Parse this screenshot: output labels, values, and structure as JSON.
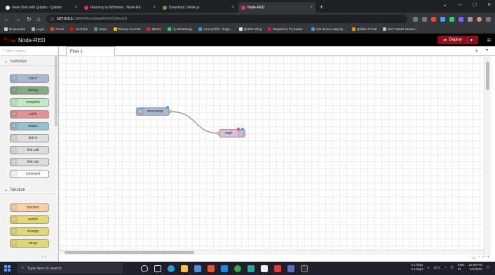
{
  "browser": {
    "tabs": [
      {
        "title": "Node Red with Qubitro - Qubitro",
        "color": "#ffffff",
        "active": false
      },
      {
        "title": "Running on Windows : Node-RE",
        "color": "#e23a3a",
        "active": false
      },
      {
        "title": "Download | Node.js",
        "color": "#5fa04e",
        "active": false
      },
      {
        "title": "Node-RED",
        "color": "#e23a3a",
        "active": true
      }
    ],
    "new_tab": "+",
    "url_host": "127.0.0.1",
    "url_rest": ":1880/#flow/b6adf00ed238ea19",
    "bookmarks": [
      {
        "label": "Bookmarks",
        "color": "#cccccc"
      },
      {
        "label": "Login",
        "color": "#aaaaaa"
      },
      {
        "label": "Gmail",
        "color": "#ea4335"
      },
      {
        "label": "YouTube",
        "color": "#ff0000"
      },
      {
        "label": "Maps",
        "color": "#34a853"
      },
      {
        "label": "Renew Account",
        "color": "#f4b400"
      },
      {
        "label": "MEGA",
        "color": "#d9272e"
      },
      {
        "label": "(1) WhatsApp",
        "color": "#25d366"
      },
      {
        "label": "Your profile - Edge...",
        "color": "#3a96dd"
      },
      {
        "label": "Qubitro Blog",
        "color": "#dddddd"
      },
      {
        "label": "Raspberry Pi (maste...",
        "color": "#c51a4a"
      },
      {
        "label": "Get device data by...",
        "color": "#4a90e2"
      },
      {
        "label": "Qubitro Portal",
        "color": "#f29111"
      },
      {
        "label": "Wi-Fi Mesh Networ...",
        "color": "#bbbbbb"
      }
    ]
  },
  "app": {
    "title": "Node-RED",
    "deploy_label": "Deploy",
    "search_placeholder": "filter nodes",
    "flow_tab": "Flow 1"
  },
  "palette": {
    "categories": [
      {
        "label": "common"
      },
      {
        "label": "function"
      }
    ],
    "common_nodes": [
      {
        "label": "inject",
        "color": "#a6bbcf"
      },
      {
        "label": "debug",
        "color": "#87a980"
      },
      {
        "label": "complete",
        "color": "#c0edc0"
      },
      {
        "label": "catch",
        "color": "#e49191"
      },
      {
        "label": "status",
        "color": "#94c1d0"
      },
      {
        "label": "link in",
        "color": "#dddddd"
      },
      {
        "label": "link call",
        "color": "#dddddd"
      },
      {
        "label": "link out",
        "color": "#dddddd"
      },
      {
        "label": "comment",
        "color": "#ffffff"
      }
    ],
    "function_nodes": [
      {
        "label": "function",
        "color": "#fdd0a2"
      },
      {
        "label": "switch",
        "color": "#e2d96e"
      },
      {
        "label": "change",
        "color": "#e2d96e"
      },
      {
        "label": "range",
        "color": "#e2d96e"
      }
    ]
  },
  "flow": {
    "nodes": [
      {
        "label": "timestamp",
        "color": "#a6bbcf"
      },
      {
        "label": "mqtt",
        "color": "#d8bfd8"
      }
    ]
  },
  "taskbar": {
    "search_placeholder": "Type here to search",
    "net_up": "0.1 kbps",
    "net_down": "0.2 kbps",
    "temp": "31°C",
    "lang": "ENG",
    "lang2": "IN",
    "time": "12:30 PM",
    "date": "5/1/2022"
  }
}
